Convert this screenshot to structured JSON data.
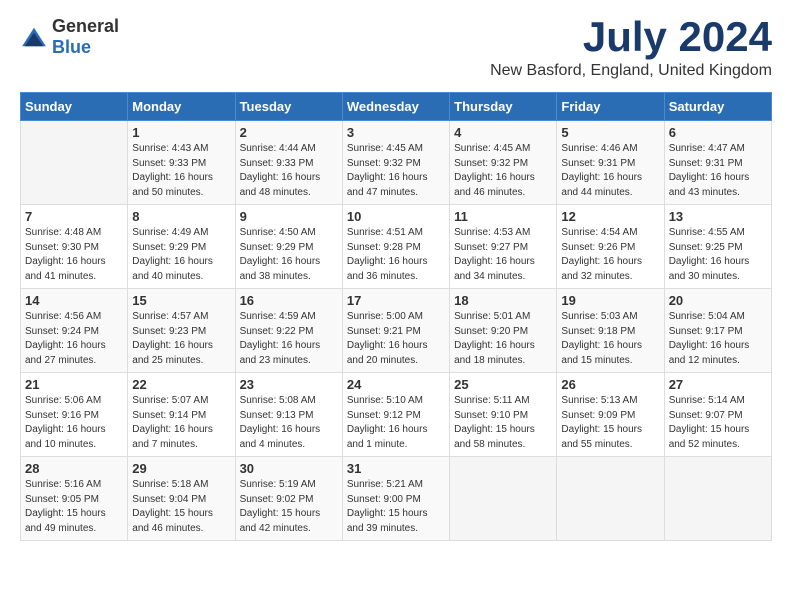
{
  "logo": {
    "text_general": "General",
    "text_blue": "Blue"
  },
  "title": {
    "month_year": "July 2024",
    "location": "New Basford, England, United Kingdom"
  },
  "calendar": {
    "headers": [
      "Sunday",
      "Monday",
      "Tuesday",
      "Wednesday",
      "Thursday",
      "Friday",
      "Saturday"
    ],
    "weeks": [
      [
        {
          "day": "",
          "info": ""
        },
        {
          "day": "1",
          "info": "Sunrise: 4:43 AM\nSunset: 9:33 PM\nDaylight: 16 hours\nand 50 minutes."
        },
        {
          "day": "2",
          "info": "Sunrise: 4:44 AM\nSunset: 9:33 PM\nDaylight: 16 hours\nand 48 minutes."
        },
        {
          "day": "3",
          "info": "Sunrise: 4:45 AM\nSunset: 9:32 PM\nDaylight: 16 hours\nand 47 minutes."
        },
        {
          "day": "4",
          "info": "Sunrise: 4:45 AM\nSunset: 9:32 PM\nDaylight: 16 hours\nand 46 minutes."
        },
        {
          "day": "5",
          "info": "Sunrise: 4:46 AM\nSunset: 9:31 PM\nDaylight: 16 hours\nand 44 minutes."
        },
        {
          "day": "6",
          "info": "Sunrise: 4:47 AM\nSunset: 9:31 PM\nDaylight: 16 hours\nand 43 minutes."
        }
      ],
      [
        {
          "day": "7",
          "info": "Sunrise: 4:48 AM\nSunset: 9:30 PM\nDaylight: 16 hours\nand 41 minutes."
        },
        {
          "day": "8",
          "info": "Sunrise: 4:49 AM\nSunset: 9:29 PM\nDaylight: 16 hours\nand 40 minutes."
        },
        {
          "day": "9",
          "info": "Sunrise: 4:50 AM\nSunset: 9:29 PM\nDaylight: 16 hours\nand 38 minutes."
        },
        {
          "day": "10",
          "info": "Sunrise: 4:51 AM\nSunset: 9:28 PM\nDaylight: 16 hours\nand 36 minutes."
        },
        {
          "day": "11",
          "info": "Sunrise: 4:53 AM\nSunset: 9:27 PM\nDaylight: 16 hours\nand 34 minutes."
        },
        {
          "day": "12",
          "info": "Sunrise: 4:54 AM\nSunset: 9:26 PM\nDaylight: 16 hours\nand 32 minutes."
        },
        {
          "day": "13",
          "info": "Sunrise: 4:55 AM\nSunset: 9:25 PM\nDaylight: 16 hours\nand 30 minutes."
        }
      ],
      [
        {
          "day": "14",
          "info": "Sunrise: 4:56 AM\nSunset: 9:24 PM\nDaylight: 16 hours\nand 27 minutes."
        },
        {
          "day": "15",
          "info": "Sunrise: 4:57 AM\nSunset: 9:23 PM\nDaylight: 16 hours\nand 25 minutes."
        },
        {
          "day": "16",
          "info": "Sunrise: 4:59 AM\nSunset: 9:22 PM\nDaylight: 16 hours\nand 23 minutes."
        },
        {
          "day": "17",
          "info": "Sunrise: 5:00 AM\nSunset: 9:21 PM\nDaylight: 16 hours\nand 20 minutes."
        },
        {
          "day": "18",
          "info": "Sunrise: 5:01 AM\nSunset: 9:20 PM\nDaylight: 16 hours\nand 18 minutes."
        },
        {
          "day": "19",
          "info": "Sunrise: 5:03 AM\nSunset: 9:18 PM\nDaylight: 16 hours\nand 15 minutes."
        },
        {
          "day": "20",
          "info": "Sunrise: 5:04 AM\nSunset: 9:17 PM\nDaylight: 16 hours\nand 12 minutes."
        }
      ],
      [
        {
          "day": "21",
          "info": "Sunrise: 5:06 AM\nSunset: 9:16 PM\nDaylight: 16 hours\nand 10 minutes."
        },
        {
          "day": "22",
          "info": "Sunrise: 5:07 AM\nSunset: 9:14 PM\nDaylight: 16 hours\nand 7 minutes."
        },
        {
          "day": "23",
          "info": "Sunrise: 5:08 AM\nSunset: 9:13 PM\nDaylight: 16 hours\nand 4 minutes."
        },
        {
          "day": "24",
          "info": "Sunrise: 5:10 AM\nSunset: 9:12 PM\nDaylight: 16 hours\nand 1 minute."
        },
        {
          "day": "25",
          "info": "Sunrise: 5:11 AM\nSunset: 9:10 PM\nDaylight: 15 hours\nand 58 minutes."
        },
        {
          "day": "26",
          "info": "Sunrise: 5:13 AM\nSunset: 9:09 PM\nDaylight: 15 hours\nand 55 minutes."
        },
        {
          "day": "27",
          "info": "Sunrise: 5:14 AM\nSunset: 9:07 PM\nDaylight: 15 hours\nand 52 minutes."
        }
      ],
      [
        {
          "day": "28",
          "info": "Sunrise: 5:16 AM\nSunset: 9:05 PM\nDaylight: 15 hours\nand 49 minutes."
        },
        {
          "day": "29",
          "info": "Sunrise: 5:18 AM\nSunset: 9:04 PM\nDaylight: 15 hours\nand 46 minutes."
        },
        {
          "day": "30",
          "info": "Sunrise: 5:19 AM\nSunset: 9:02 PM\nDaylight: 15 hours\nand 42 minutes."
        },
        {
          "day": "31",
          "info": "Sunrise: 5:21 AM\nSunset: 9:00 PM\nDaylight: 15 hours\nand 39 minutes."
        },
        {
          "day": "",
          "info": ""
        },
        {
          "day": "",
          "info": ""
        },
        {
          "day": "",
          "info": ""
        }
      ]
    ]
  }
}
